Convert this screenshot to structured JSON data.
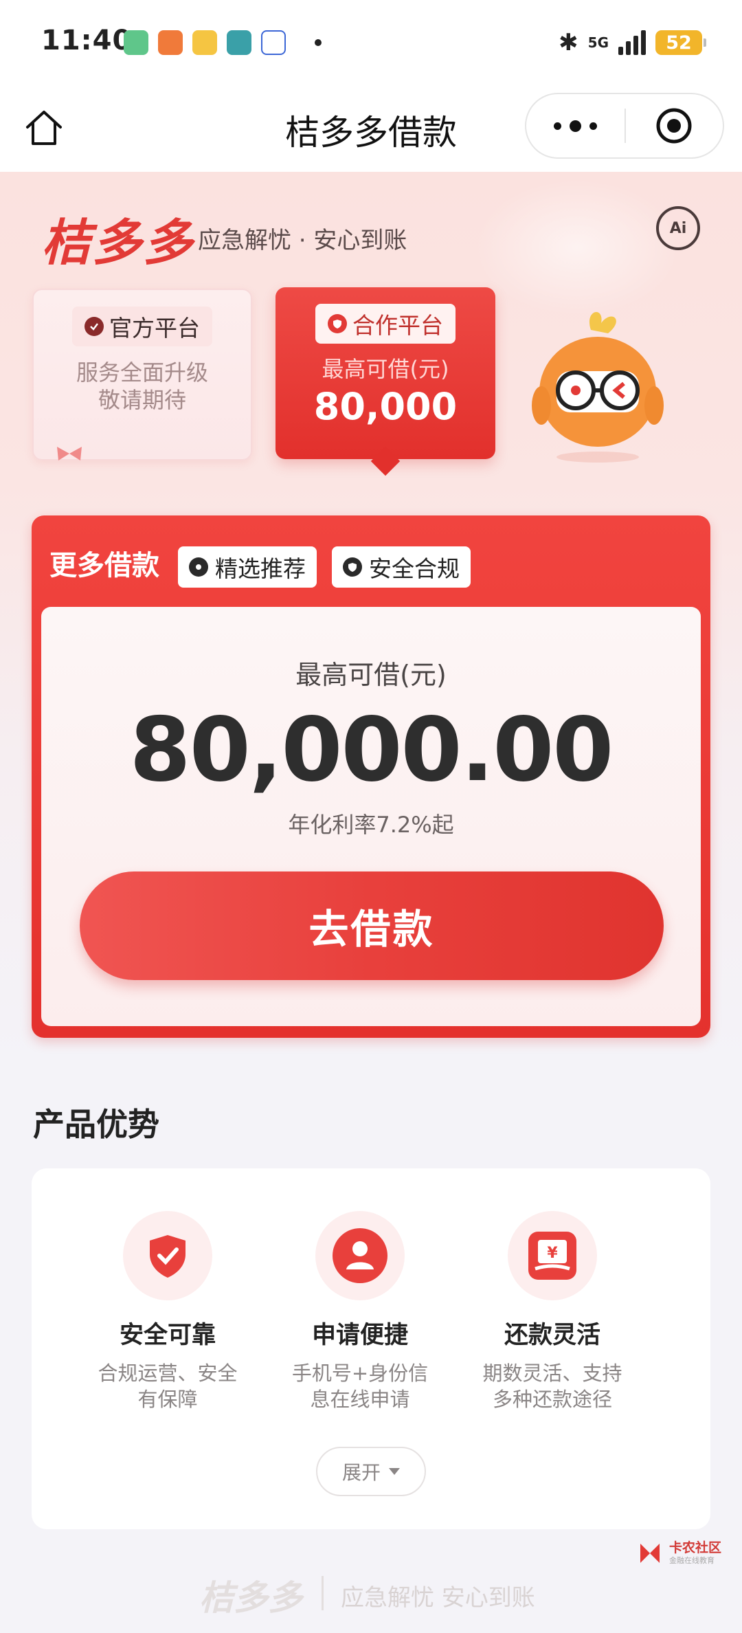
{
  "status_bar": {
    "time": "11:40",
    "network": "5G",
    "battery": "52"
  },
  "nav": {
    "title": "桔多多借款"
  },
  "brand": {
    "name": "桔多多",
    "slogan": "应急解忧 · 安心到账",
    "ai_label": "Ai"
  },
  "platforms": {
    "official": {
      "tag": "官方平台",
      "desc_line1": "服务全面升级",
      "desc_line2": "敬请期待"
    },
    "partner": {
      "tag": "合作平台",
      "label": "最高可借(元)",
      "amount": "80,000"
    }
  },
  "loan": {
    "section_title": "更多借款",
    "badges": [
      "精选推荐",
      "安全合规"
    ],
    "label": "最高可借(元)",
    "amount": "80,000.00",
    "rate": "年化利率7.2%起",
    "cta": "去借款"
  },
  "advantages": {
    "title": "产品优势",
    "items": [
      {
        "icon": "shield-check-icon",
        "title": "安全可靠",
        "desc_line1": "合规运营、安全",
        "desc_line2": "有保障"
      },
      {
        "icon": "user-icon",
        "title": "申请便捷",
        "desc_line1": "手机号+身份信",
        "desc_line2": "息在线申请"
      },
      {
        "icon": "yuan-receipt-icon",
        "title": "还款灵活",
        "desc_line1": "期数灵活、支持",
        "desc_line2": "多种还款途径"
      }
    ],
    "expand_label": "展开"
  },
  "footer": {
    "brand": "桔多多",
    "slogan": "应急解忧 安心到账"
  },
  "watermark": {
    "name": "卡农社区",
    "sub": "金融在线教育"
  },
  "colors": {
    "primary": "#e4312d",
    "hero_bg": "#fbe2df",
    "page_bg": "#f4f3f8"
  }
}
